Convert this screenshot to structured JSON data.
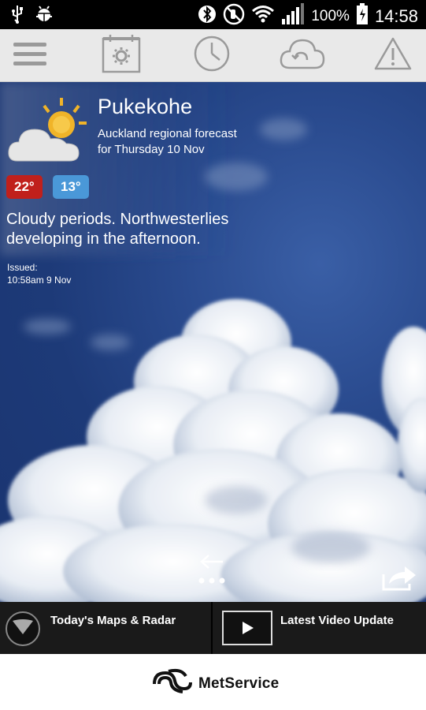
{
  "status_bar": {
    "battery": "100%",
    "time": "14:58",
    "icons": [
      "usb-icon",
      "android-debug-icon",
      "bluetooth-icon",
      "mute-icon",
      "wifi-icon",
      "signal-icon",
      "battery-icon"
    ]
  },
  "toolbar": {
    "items": [
      "menu-icon",
      "settings-icon",
      "history-icon",
      "refresh-icon",
      "warning-icon"
    ]
  },
  "forecast": {
    "location": "Pukekohe",
    "region": "Auckland regional forecast",
    "date_line": "for Thursday 10 Nov",
    "max_temp": "22°",
    "min_temp": "13°",
    "summary": "Cloudy periods. Northwesterlies developing in the afternoon.",
    "issued_label": "Issued:",
    "issued_time": "10:58am 9 Nov",
    "condition_icon": "partly-cloudy-icon"
  },
  "bottom_nav": {
    "maps_label": "Today's Maps & Radar",
    "video_label": "Latest Video Update"
  },
  "footer": {
    "brand": "MetService"
  },
  "colors": {
    "max_temp_badge": "#c0201c",
    "min_temp_badge": "#4a98d8",
    "toolbar_bg": "#e9e9e9",
    "bottom_bar_bg": "#1a1a1a"
  }
}
